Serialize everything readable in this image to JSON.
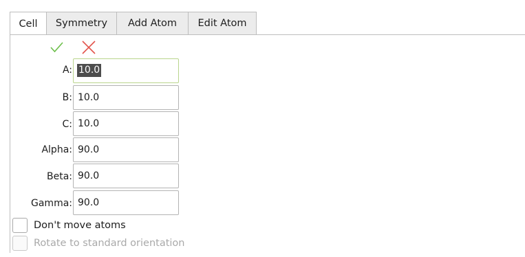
{
  "tabs": [
    {
      "label": "Cell",
      "active": true
    },
    {
      "label": "Symmetry",
      "active": false
    },
    {
      "label": "Add Atom",
      "active": false
    },
    {
      "label": "Edit Atom",
      "active": false
    }
  ],
  "toolbar": {
    "apply_icon": "checkmark-icon",
    "apply_color": "#6cbf4a",
    "cancel_icon": "cross-icon",
    "cancel_color": "#e2524a"
  },
  "cell": {
    "a": {
      "label": "A:",
      "value": "10.0"
    },
    "b": {
      "label": "B:",
      "value": "10.0"
    },
    "c": {
      "label": "C:",
      "value": "10.0"
    },
    "alpha": {
      "label": "Alpha:",
      "value": "90.0"
    },
    "beta": {
      "label": "Beta:",
      "value": "90.0"
    },
    "gamma": {
      "label": "Gamma:",
      "value": "90.0"
    }
  },
  "options": {
    "dont_move_atoms": {
      "label": "Don't move atoms",
      "checked": false,
      "enabled": true
    },
    "rotate_standard": {
      "label": "Rotate to standard orientation",
      "checked": false,
      "enabled": false
    }
  }
}
